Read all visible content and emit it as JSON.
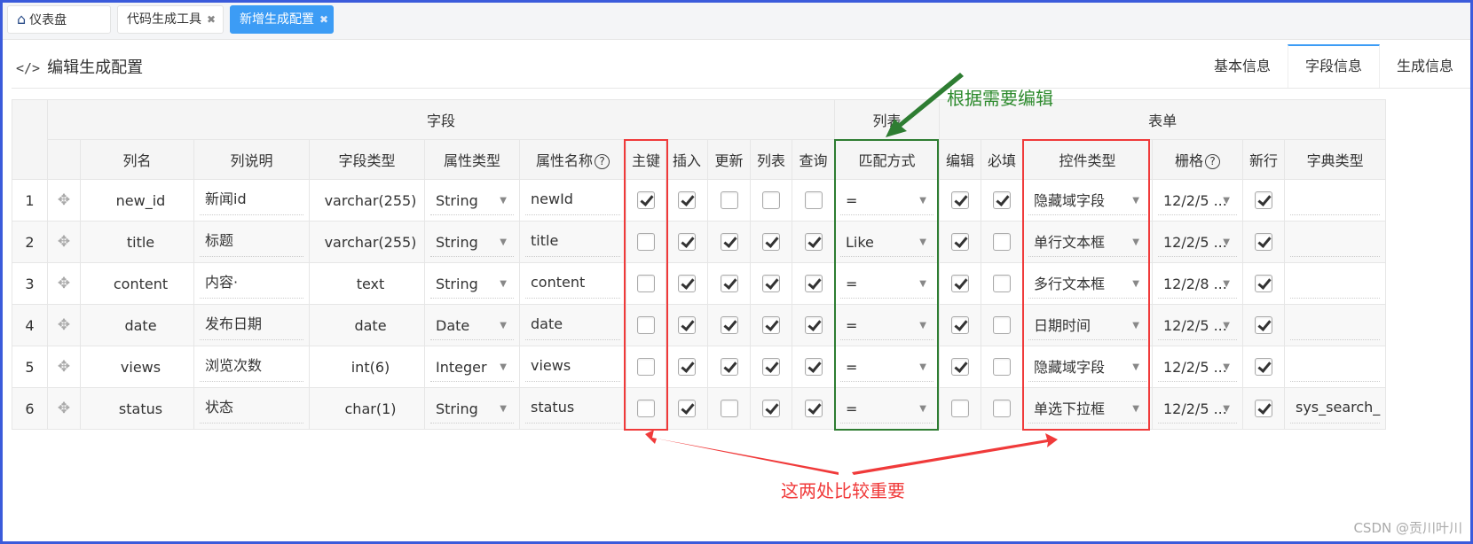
{
  "nav_tabs": [
    {
      "label": "仪表盘",
      "icon": "home-icon",
      "closable": false,
      "active": false
    },
    {
      "label": "代码生成工具",
      "closable": true,
      "active": false
    },
    {
      "label": "新增生成配置",
      "closable": true,
      "active": true
    }
  ],
  "close_glyph": "✖",
  "page": {
    "title": "编辑生成配置",
    "title_icon": "</>"
  },
  "panel_tabs": [
    {
      "label": "基本信息",
      "active": false
    },
    {
      "label": "字段信息",
      "active": true
    },
    {
      "label": "生成信息",
      "active": false
    }
  ],
  "table": {
    "group_headers": {
      "field": "字段",
      "list": "列表",
      "form": "表单"
    },
    "columns": {
      "col_name": "列名",
      "col_comment": "列说明",
      "col_type": "字段类型",
      "java_type": "属性类型",
      "java_field": "属性名称",
      "pk": "主键",
      "insert": "插入",
      "update": "更新",
      "list": "列表",
      "query": "查询",
      "query_type": "匹配方式",
      "edit": "编辑",
      "required": "必填",
      "html_type": "控件类型",
      "grid": "栅格",
      "new_row": "新行",
      "dict_type": "字典类型"
    },
    "help_glyph": "?",
    "rows": [
      {
        "index": "1",
        "col_name": "new_id",
        "col_comment": "新闻id",
        "col_type": "varchar(255)",
        "java_type": "String",
        "java_field": "newId",
        "pk": true,
        "insert": true,
        "update": false,
        "list": false,
        "query": false,
        "query_type": "=",
        "edit": true,
        "required": true,
        "html_type": "隐藏域字段",
        "grid": "12/2/5 ...",
        "new_row": true,
        "dict_type": ""
      },
      {
        "index": "2",
        "col_name": "title",
        "col_comment": "标题",
        "col_type": "varchar(255)",
        "java_type": "String",
        "java_field": "title",
        "pk": false,
        "insert": true,
        "update": true,
        "list": true,
        "query": true,
        "query_type": "Like",
        "edit": true,
        "required": false,
        "html_type": "单行文本框",
        "grid": "12/2/5 ...",
        "new_row": true,
        "dict_type": ""
      },
      {
        "index": "3",
        "col_name": "content",
        "col_comment": "内容·",
        "col_type": "text",
        "java_type": "String",
        "java_field": "content",
        "pk": false,
        "insert": true,
        "update": true,
        "list": true,
        "query": true,
        "query_type": "=",
        "edit": true,
        "required": false,
        "html_type": "多行文本框",
        "grid": "12/2/8 ...",
        "new_row": true,
        "dict_type": ""
      },
      {
        "index": "4",
        "col_name": "date",
        "col_comment": "发布日期",
        "col_type": "date",
        "java_type": "Date",
        "java_field": "date",
        "pk": false,
        "insert": true,
        "update": true,
        "list": true,
        "query": true,
        "query_type": "=",
        "edit": true,
        "required": false,
        "html_type": "日期时间",
        "grid": "12/2/5 ...",
        "new_row": true,
        "dict_type": ""
      },
      {
        "index": "5",
        "col_name": "views",
        "col_comment": "浏览次数",
        "col_type": "int(6)",
        "java_type": "Integer",
        "java_field": "views",
        "pk": false,
        "insert": true,
        "update": true,
        "list": true,
        "query": true,
        "query_type": "=",
        "edit": true,
        "required": false,
        "html_type": "隐藏域字段",
        "grid": "12/2/5 ...",
        "new_row": true,
        "dict_type": ""
      },
      {
        "index": "6",
        "col_name": "status",
        "col_comment": "状态",
        "col_type": "char(1)",
        "java_type": "String",
        "java_field": "status",
        "pk": false,
        "insert": true,
        "update": false,
        "list": true,
        "query": true,
        "query_type": "=",
        "edit": false,
        "required": false,
        "html_type": "单选下拉框",
        "grid": "12/2/5 ...",
        "new_row": true,
        "dict_type": "sys_search_"
      }
    ]
  },
  "annotations": {
    "green_note": "根据需要编辑",
    "red_note": "这两处比较重要",
    "green_color": "#2e7d32",
    "red_color": "#f03a3a"
  },
  "watermark": "CSDN @贡川叶川",
  "colors": {
    "accent": "#3c9cf5",
    "frame": "#3b5bdb"
  }
}
